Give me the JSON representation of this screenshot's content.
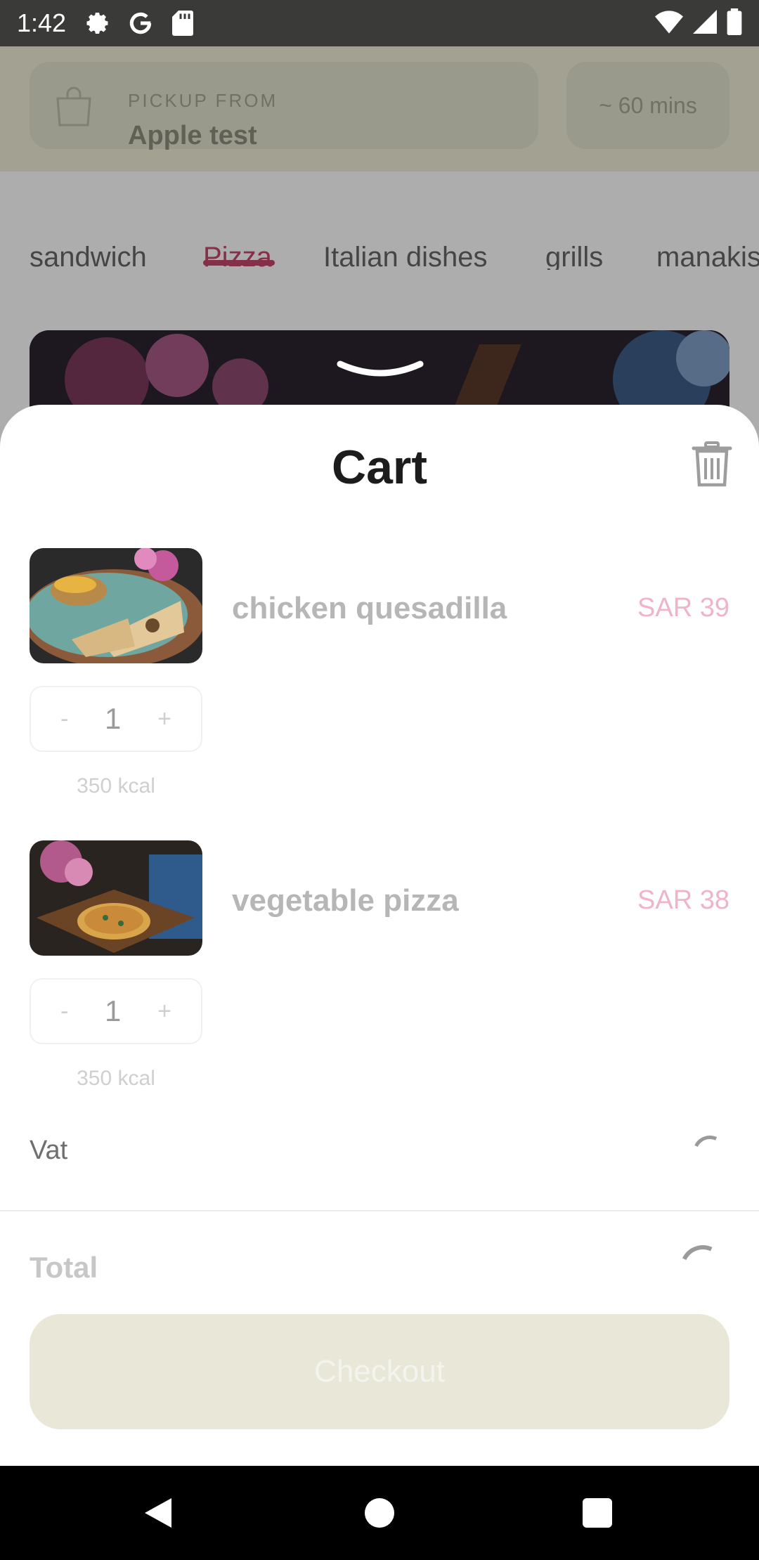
{
  "status_bar": {
    "time": "1:42",
    "icons": [
      "settings-icon",
      "google-icon",
      "sd-card-icon",
      "wifi-icon",
      "cell-signal-icon",
      "battery-icon"
    ]
  },
  "header": {
    "pickup_label": "PICKUP FROM",
    "pickup_name": "Apple test",
    "eta": "~ 60 mins"
  },
  "categories": [
    {
      "label": "sandwich",
      "active": false
    },
    {
      "label": "Pizza",
      "active": true
    },
    {
      "label": "Italian dishes",
      "active": false
    },
    {
      "label": "grills",
      "active": false
    },
    {
      "label": "manakis",
      "active": false
    }
  ],
  "cart": {
    "title": "Cart",
    "items": [
      {
        "name": "chicken quesadilla",
        "price": "SAR 39",
        "qty": "1",
        "kcal": "350 kcal",
        "minus": "-",
        "plus": "+"
      },
      {
        "name": "vegetable pizza",
        "price": "SAR 38",
        "qty": "1",
        "kcal": "350 kcal",
        "minus": "-",
        "plus": "+"
      }
    ],
    "vat_label": "Vat",
    "total_label": "Total",
    "checkout_label": "Checkout"
  },
  "colors": {
    "accent": "#c6466b",
    "price": "#efb4c6",
    "header_band": "#efeed8",
    "checkout_bg": "#e8e7d8"
  }
}
